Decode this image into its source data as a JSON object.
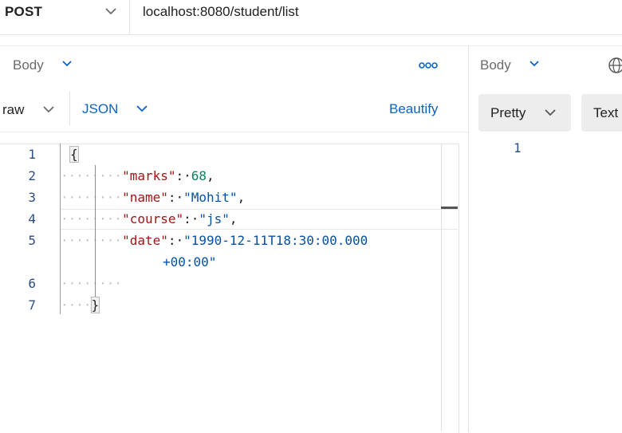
{
  "request": {
    "method": "POST",
    "url": "localhost:8080/student/list",
    "tab_label": "Body",
    "body_mode": "raw",
    "body_format": "JSON",
    "beautify_label": "Beautify"
  },
  "editor": {
    "lines": [
      {
        "num": "1",
        "dots": "",
        "text": "{"
      },
      {
        "num": "2",
        "dots": "········",
        "key": "\"marks\"",
        "sep": ":·",
        "val": "68",
        "val_type": "num",
        "tail": ","
      },
      {
        "num": "3",
        "dots": "········",
        "key": "\"name\"",
        "sep": ":·",
        "val": "\"Mohit\"",
        "val_type": "str",
        "tail": ","
      },
      {
        "num": "4",
        "dots": "········",
        "key": "\"course\"",
        "sep": ":·",
        "val": "\"js\"",
        "val_type": "str",
        "tail": ","
      },
      {
        "num": "5",
        "dots": "········",
        "key": "\"date\"",
        "sep": ":·",
        "val": "\"1990-12-11T18:30:00.000",
        "val_type": "str",
        "tail": ""
      },
      {
        "num": "",
        "dots": "",
        "text": "+00:00\"",
        "wrap": true
      },
      {
        "num": "6",
        "dots": "········",
        "text": ""
      },
      {
        "num": "7",
        "dots": "····",
        "text": "}"
      }
    ]
  },
  "response": {
    "tab_label": "Body",
    "view_mode": "Pretty",
    "text_label": "Text",
    "line_number": "1"
  },
  "icons": {
    "chevron": "chevron-down-icon",
    "more": "more-options-icon",
    "globe": "globe-icon"
  },
  "colors": {
    "accent": "#0b63c5",
    "key": "#a31515",
    "number": "#098658",
    "string": "#0451a5"
  }
}
